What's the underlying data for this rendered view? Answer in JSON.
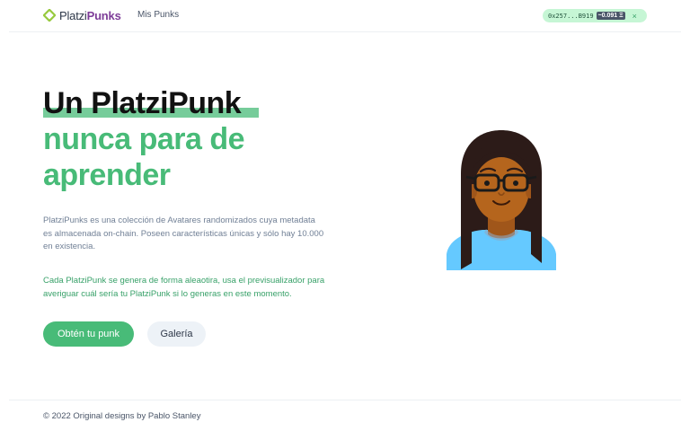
{
  "header": {
    "logo": {
      "icon": "platzi-logo-icon",
      "part1": "Platzi",
      "part2": "Punks"
    },
    "nav": [
      {
        "label": "Mis Punks"
      }
    ],
    "wallet": {
      "address": "0x257...B919",
      "balance": "~0.091 Ξ",
      "close_icon": "×"
    }
  },
  "hero": {
    "title_line1": "Un PlatziPunk",
    "title_line2": "nunca para de",
    "title_line3": "aprender",
    "description": "PlatziPunks es una colección de Avatares randomizados cuya metadata es almacenada on-chain. Poseen características únicas y sólo hay 10.000 en existencia.",
    "description2": "Cada PlatziPunk se genera de forma aleaotira, usa el previsualizador para averiguar cuál sería tu PlatziPunk si lo generas en este momento.",
    "primary_button": "Obtén tu punk",
    "secondary_button": "Galería"
  },
  "avatar": {
    "icon": "punk-avatar-image",
    "accent_colors": {
      "skin": "#B5651D",
      "hair": "#2C1B18",
      "shirt": "#65C9FF"
    }
  },
  "footer": {
    "text": "© 2022 Original designs by Pablo Stanley"
  },
  "colors": {
    "brand_green": "#48BB78",
    "brand_purple": "#7D3C98"
  }
}
